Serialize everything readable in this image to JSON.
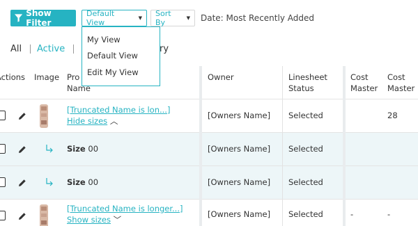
{
  "toolbar": {
    "show_filter_label": "Show Filter",
    "default_view_label": "Default View",
    "sort_by_label": "Sort By",
    "date_label": "Date: Most Recently Added"
  },
  "tabs": {
    "all": "All",
    "active": "Active",
    "history_fragment": "ry"
  },
  "view_menu": {
    "items": [
      "My View",
      "Default View",
      "Edit My View"
    ]
  },
  "table": {
    "headers": {
      "actions": "Actions",
      "image": "Image",
      "product_name_line1": "Pro",
      "product_name_line2": "Name",
      "owner": "Owner",
      "linesheet_status_line1": "Linesheet",
      "linesheet_status_line2": "Status",
      "cost_master_1_line1": "Cost",
      "cost_master_1_line2": "Master",
      "cost_master_2_line1": "Cost",
      "cost_master_2_line2": "Master"
    },
    "rows": [
      {
        "name": "[Truncated Name is lon...]",
        "toggle": "Hide sizes",
        "owner": "[Owners Name]",
        "status": "Selected",
        "cost1": "",
        "cost2": "28"
      },
      {
        "size_label": "Size",
        "size_value": "00",
        "owner": "[Owners Name]",
        "status": "Selected",
        "cost1": "",
        "cost2": ""
      },
      {
        "size_label": "Size",
        "size_value": "00",
        "owner": "[Owners Name]",
        "status": "Selected",
        "cost1": "",
        "cost2": ""
      },
      {
        "name": "[Truncated Name is longer...]",
        "toggle": "Show sizes",
        "owner": "[Owners Name]",
        "status": "Selected",
        "cost1": "-",
        "cost2": "-"
      }
    ]
  },
  "colors": {
    "accent": "#26b3c2",
    "row_alt": "#edf6f8"
  }
}
